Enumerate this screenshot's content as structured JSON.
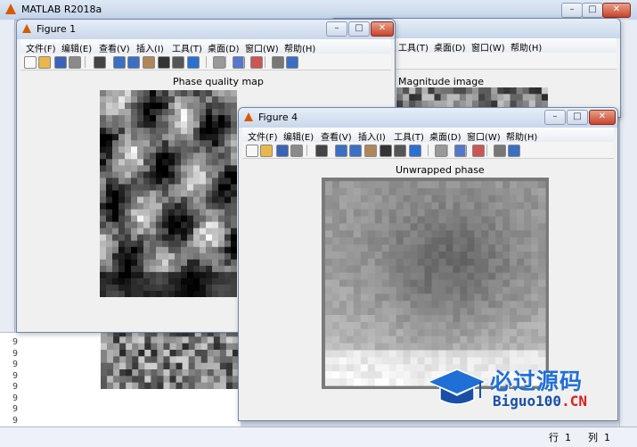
{
  "matlab": {
    "title": "MATLAB R2018a",
    "status_row_label": "行",
    "status_row_value": "1",
    "status_col_label": "列",
    "status_col_value": "1",
    "cmd_prefix": [
      "9",
      "9",
      "9",
      "9",
      "9",
      "9",
      "9",
      "9"
    ]
  },
  "menu": [
    "文件(F)",
    "编辑(E)",
    "查看(V)",
    "插入(I)",
    "工具(T)",
    "桌面(D)",
    "窗口(W)",
    "帮助(H)"
  ],
  "figure1": {
    "title": "Figure 1",
    "axes_title": "Phase quality map"
  },
  "figure_mag": {
    "axes_title": "Magnitude image"
  },
  "figure4": {
    "title": "Figure 4",
    "axes_title": "Unwrapped phase"
  },
  "watermark": {
    "cn": "必过源码",
    "en_prefix": "Biguo100",
    "en_suffix": ".CN"
  },
  "colors": {
    "accent": "#1f6fd6",
    "matlab_orange": "#d75a00"
  },
  "icons": [
    "new-file-icon",
    "open-folder-icon",
    "save-icon",
    "print-icon",
    "pointer-icon",
    "zoom-in-icon",
    "zoom-out-icon",
    "pan-icon",
    "rotate-icon",
    "data-cursor-icon",
    "brush-icon",
    "link-icon",
    "colorbar-icon",
    "legend-icon",
    "hide-plot-tools-icon",
    "show-plot-tools-icon"
  ]
}
